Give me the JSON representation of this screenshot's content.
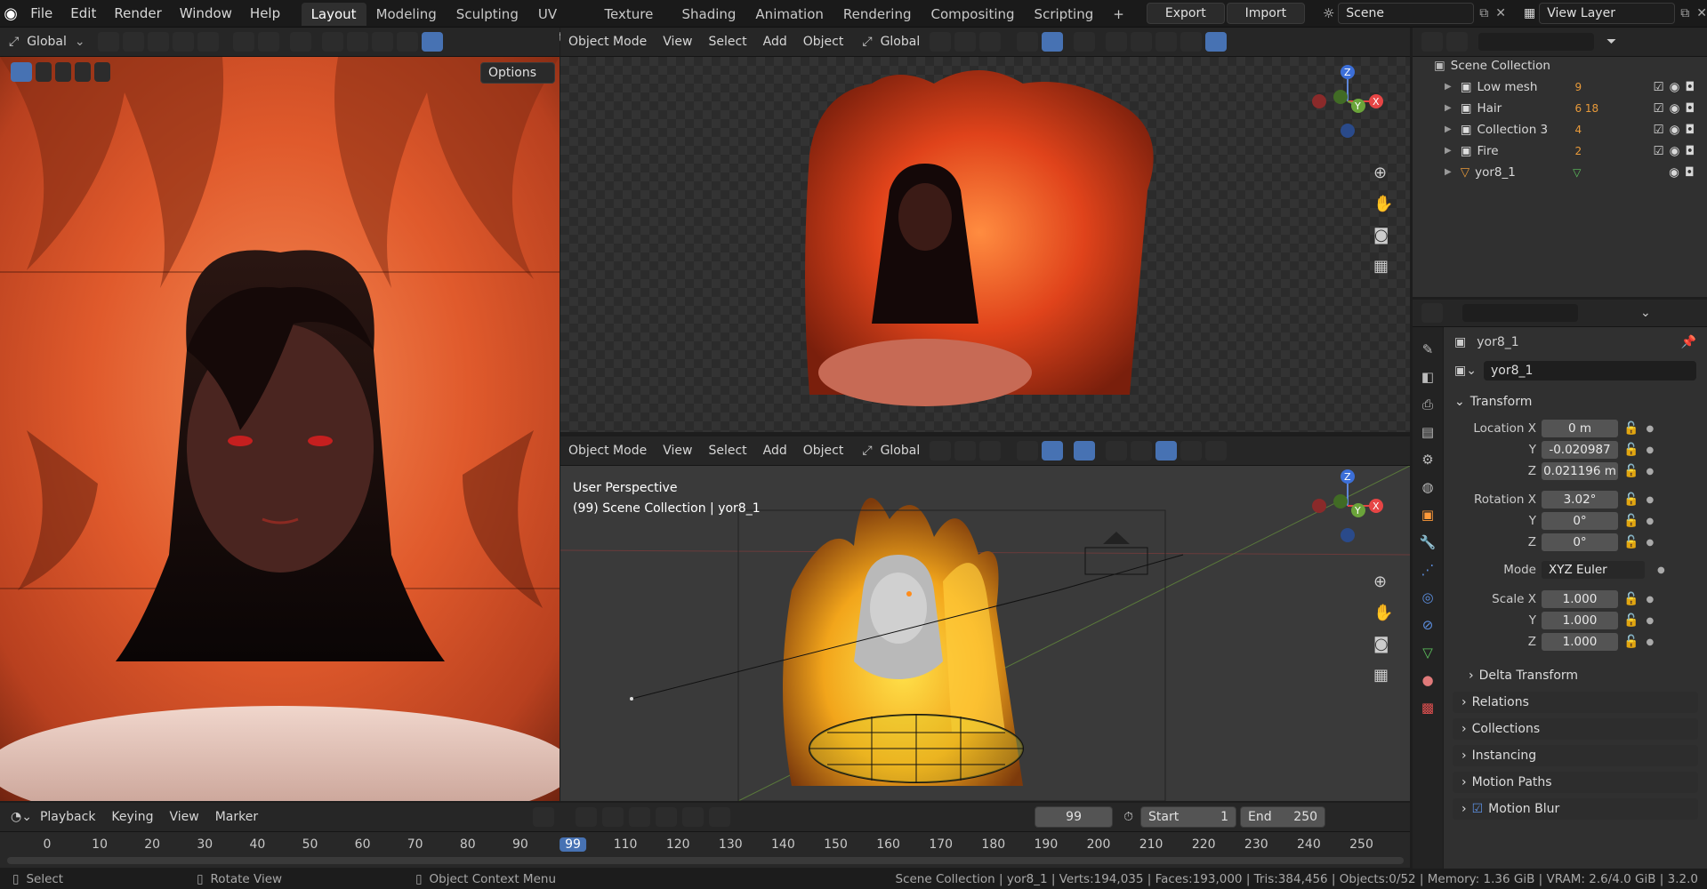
{
  "topbar": {
    "menus": [
      "File",
      "Edit",
      "Render",
      "Window",
      "Help"
    ],
    "workspaces": [
      "Layout",
      "Modeling",
      "Sculpting",
      "UV Editing",
      "Texture Paint",
      "Shading",
      "Animation",
      "Rendering",
      "Compositing",
      "Scripting"
    ],
    "active_workspace": "Layout",
    "add_tab": "+",
    "export_label": "Export",
    "import_label": "Import",
    "scene_label": "Scene",
    "view_layer_label": "View Layer"
  },
  "left_editor": {
    "orientation": "Global",
    "options_label": "Options"
  },
  "viewport_top": {
    "mode": "Object Mode",
    "menus": [
      "View",
      "Select",
      "Add",
      "Object"
    ],
    "orientation": "Global"
  },
  "viewport_bottom": {
    "mode": "Object Mode",
    "menus": [
      "View",
      "Select",
      "Add",
      "Object"
    ],
    "orientation": "Global",
    "overlay_title": "User Perspective",
    "overlay_sub": "(99) Scene Collection | yor8_1"
  },
  "gizmo": {
    "z": "Z",
    "y": "Y",
    "x": "X"
  },
  "outliner": {
    "root": "Scene Collection",
    "items": [
      {
        "name": "Low mesh",
        "badge": "9"
      },
      {
        "name": "Hair",
        "badge": "6 18"
      },
      {
        "name": "Collection 3",
        "badge": "4"
      },
      {
        "name": "Fire",
        "badge": "2"
      },
      {
        "name": "yor8_1",
        "badge": ""
      }
    ]
  },
  "properties": {
    "object_name": "yor8_1",
    "data_name": "yor8_1",
    "transform_label": "Transform",
    "location": {
      "label": "Location X",
      "x": "0 m",
      "y": "-0.020987",
      "z": "0.021196 m"
    },
    "rotation": {
      "label": "Rotation X",
      "x": "3.02°",
      "y": "0°",
      "z": "0°"
    },
    "mode_label": "Mode",
    "mode_value": "XYZ Euler",
    "scale": {
      "label": "Scale X",
      "x": "1.000",
      "y": "1.000",
      "z": "1.000"
    },
    "axis_y": "Y",
    "axis_z": "Z",
    "sections": [
      "Delta Transform",
      "Relations",
      "Collections",
      "Instancing",
      "Motion Paths",
      "Motion Blur"
    ]
  },
  "timeline": {
    "menus": [
      "Playback",
      "Keying",
      "View",
      "Marker"
    ],
    "current_frame": "99",
    "start_label": "Start",
    "start_value": "1",
    "end_label": "End",
    "end_value": "250",
    "ticks": [
      "0",
      "10",
      "20",
      "30",
      "40",
      "50",
      "60",
      "70",
      "80",
      "90",
      "99",
      "110",
      "120",
      "130",
      "140",
      "150",
      "160",
      "170",
      "180",
      "190",
      "200",
      "210",
      "220",
      "230",
      "240",
      "250"
    ]
  },
  "statusbar": {
    "select": "Select",
    "rotate": "Rotate View",
    "context": "Object Context Menu",
    "stats": "Scene Collection | yor8_1 | Verts:194,035 | Faces:193,000 | Tris:384,456 | Objects:0/52 | Memory: 1.36 GiB | VRAM: 2.6/4.0 GiB | 3.2.0"
  }
}
